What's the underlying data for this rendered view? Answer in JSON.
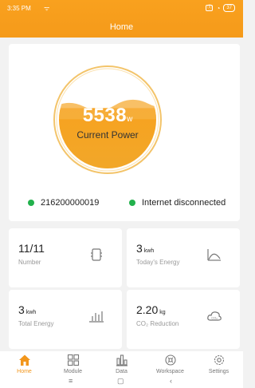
{
  "status_bar": {
    "time": "3:35 PM",
    "signal": "ᯤ",
    "sim": "ⓧ",
    "wifi": "◔",
    "battery": "37"
  },
  "header": {
    "title": "Home"
  },
  "power": {
    "value": "5538",
    "unit": "w",
    "label": "Current Power",
    "fill_level": 0.62
  },
  "device": {
    "serial": "216200000019",
    "internet_status": "Internet disconnected",
    "status_color": "#22b14c"
  },
  "tiles": [
    {
      "value": "11/11",
      "unit": "",
      "label": "Number",
      "icon": "device-icon"
    },
    {
      "value": "3",
      "unit": "kwh",
      "label": "Today's Energy",
      "icon": "area-chart-icon"
    },
    {
      "value": "3",
      "unit": "kwh",
      "label": "Total Energy",
      "icon": "bar-chart-icon"
    },
    {
      "value": "2.20",
      "unit": "kg",
      "label": "CO₂ Reduction",
      "icon": "co2-cloud-icon"
    }
  ],
  "tabs": [
    {
      "label": "Home",
      "icon": "home-icon",
      "active": true
    },
    {
      "label": "Module",
      "icon": "module-icon",
      "active": false
    },
    {
      "label": "Data",
      "icon": "data-icon",
      "active": false
    },
    {
      "label": "Workspace",
      "icon": "workspace-icon",
      "active": false
    },
    {
      "label": "Settings",
      "icon": "settings-icon",
      "active": false
    }
  ],
  "system_nav": {
    "menu": "≡",
    "home": "▢",
    "back": "‹"
  },
  "colors": {
    "accent": "#f59a1a",
    "online": "#22b14c"
  }
}
